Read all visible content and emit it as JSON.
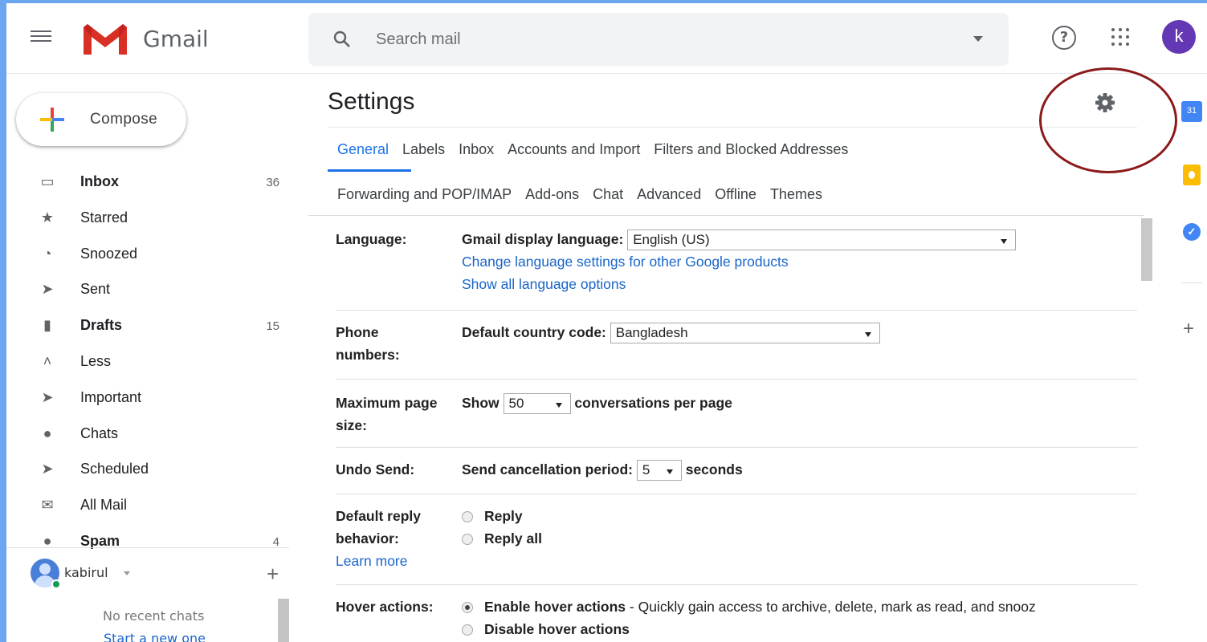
{
  "header": {
    "brand": "Gmail",
    "search_placeholder": "Search mail",
    "avatar_letter": "k",
    "help_glyph": "?"
  },
  "sidebar": {
    "compose_label": "Compose",
    "items": [
      {
        "label": "Inbox",
        "count": "36",
        "icon": "inbox-icon",
        "bold": true
      },
      {
        "label": "Starred",
        "count": "",
        "icon": "star-icon",
        "bold": false
      },
      {
        "label": "Snoozed",
        "count": "",
        "icon": "clock-icon",
        "bold": false
      },
      {
        "label": "Sent",
        "count": "",
        "icon": "send-icon",
        "bold": false
      },
      {
        "label": "Drafts",
        "count": "15",
        "icon": "draft-icon",
        "bold": true
      },
      {
        "label": "Less",
        "count": "",
        "icon": "chevron-up-icon",
        "bold": false
      },
      {
        "label": "Important",
        "count": "",
        "icon": "important-icon",
        "bold": false
      },
      {
        "label": "Chats",
        "count": "",
        "icon": "chat-icon",
        "bold": false
      },
      {
        "label": "Scheduled",
        "count": "",
        "icon": "scheduled-send-icon",
        "bold": false
      },
      {
        "label": "All Mail",
        "count": "",
        "icon": "mail-icon",
        "bold": false
      },
      {
        "label": "Spam",
        "count": "4",
        "icon": "spam-icon",
        "bold": true
      }
    ],
    "chat": {
      "user": "kabirul",
      "add": "+",
      "empty": "No recent chats",
      "start": "Start a new one"
    }
  },
  "main": {
    "title": "Settings",
    "tabs_row1": [
      "General",
      "Labels",
      "Inbox",
      "Accounts and Import",
      "Filters and Blocked Addresses"
    ],
    "tabs_row2": [
      "Forwarding and POP/IMAP",
      "Add-ons",
      "Chat",
      "Advanced",
      "Offline",
      "Themes"
    ],
    "active_tab": "General",
    "settings": {
      "language": {
        "label": "Language:",
        "field": "Gmail display language:",
        "value": "English (US)",
        "link1": "Change language settings for other Google products",
        "link2": "Show all language options"
      },
      "phone": {
        "label_line1": "Phone",
        "label_line2": "numbers:",
        "field": "Default country code:",
        "value": "Bangladesh"
      },
      "pagesize": {
        "label_line1": "Maximum page",
        "label_line2": "size:",
        "pre": "Show",
        "value": "50",
        "post": "conversations per page"
      },
      "undo": {
        "label": "Undo Send:",
        "field": "Send cancellation period:",
        "value": "5",
        "post": "seconds"
      },
      "reply": {
        "label_line1": "Default reply",
        "label_line2": "behavior:",
        "learn_more": "Learn more",
        "option1": "Reply",
        "option2": "Reply all",
        "selected": "none"
      },
      "hover": {
        "label": "Hover actions:",
        "option1": "Enable hover actions",
        "option1_desc": " - Quickly gain access to archive, delete, mark as read, and snooz",
        "option2": "Disable hover actions",
        "selected": "Enable hover actions"
      }
    }
  },
  "right_rail": {
    "calendar_text": "31",
    "add": "+"
  },
  "colors": {
    "accent_blue": "#1a73e8",
    "link_blue": "#1a65c9",
    "avatar_purple": "#6437b5",
    "annotation_red": "#8b1a1a",
    "background_blue": "#6aa7f0"
  }
}
